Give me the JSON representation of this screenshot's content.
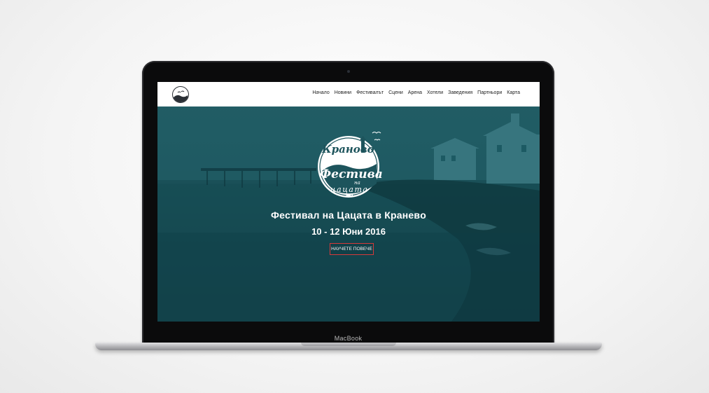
{
  "nav": {
    "items": [
      "Начало",
      "Новини",
      "Фестивалът",
      "Сцени",
      "Арена",
      "Хотели",
      "Заведения",
      "Партньори",
      "Карта"
    ]
  },
  "hero": {
    "logo_line1": "Краново",
    "logo_line2": "Фестивал",
    "logo_line3": "на",
    "logo_line4": "цацата",
    "title": "Фестивал на Цацата в Краневo",
    "dates": "10 - 12 Юни 2016",
    "cta_label": "НАУЧЕТЕ ПОВЕЧЕ"
  },
  "device": {
    "brand": "MacBook"
  },
  "colors": {
    "hero_teal": "#1d545c",
    "button_border": "#d63a3a",
    "header_bg": "#ffffff"
  }
}
